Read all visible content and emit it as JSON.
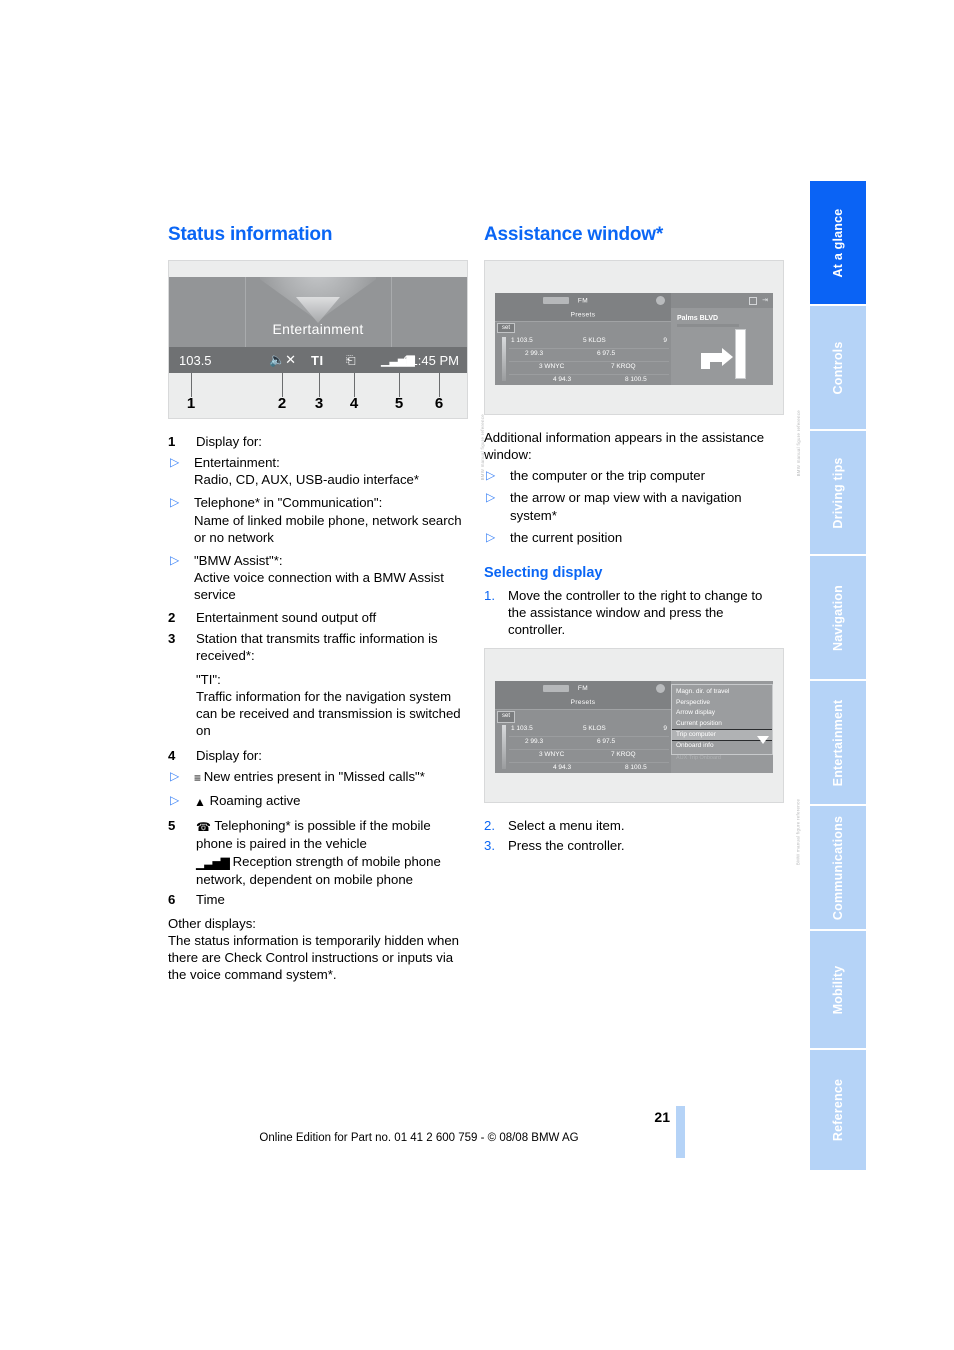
{
  "page": {
    "number": "21",
    "footer": "Online Edition for Part no. 01 41 2 600 759 - © 08/08 BMW AG",
    "accent_blue": "#0a66f5",
    "tab_blue": "#b5d3f7",
    "tab_active_blue": "#0a63f5"
  },
  "tabs": [
    {
      "label": "At a glance",
      "active": true
    },
    {
      "label": "Controls",
      "active": false
    },
    {
      "label": "Driving tips",
      "active": false
    },
    {
      "label": "Navigation",
      "active": false
    },
    {
      "label": "Entertainment",
      "active": false
    },
    {
      "label": "Communications",
      "active": false
    },
    {
      "label": "Mobility",
      "active": false
    },
    {
      "label": "Reference",
      "active": false
    }
  ],
  "left": {
    "title": "Status information",
    "figure": {
      "mode_label": "Entertainment",
      "status": {
        "frequency": "103.5",
        "mute_icon": "speaker-muted-icon",
        "ti": "TI",
        "message_icon": "message-icon",
        "signal_icon": "signal-bars-icon",
        "time": "01:45 PM"
      },
      "callouts": [
        "1",
        "2",
        "3",
        "4",
        "5",
        "6"
      ]
    },
    "items": [
      {
        "num": "1",
        "text": "Display for:",
        "subs": [
          "Entertainment:\nRadio, CD, AUX, USB-audio interface*",
          "Telephone* in \"Communication\":\nName of linked mobile phone, network search or no network",
          "\"BMW Assist\"*:\nActive voice connection with a BMW Assist service"
        ]
      },
      {
        "num": "2",
        "text": "Entertainment sound output off",
        "subs": []
      },
      {
        "num": "3",
        "text": "Station that transmits traffic information is received*:",
        "extra": "\"TI\":\nTraffic information for the navigation system can be received and transmission is switched on",
        "subs": []
      },
      {
        "num": "4",
        "text": "Display for:",
        "subs_icon": [
          {
            "icon": "list-icon",
            "text": "New entries present in \"Missed calls\"*"
          },
          {
            "icon": "triangle-icon",
            "text": "Roaming active"
          }
        ],
        "subs": []
      },
      {
        "num": "5",
        "icon_lines": [
          {
            "icon": "phone-handset-icon",
            "text": "Telephoning* is possible if the mobile phone is paired in the vehicle"
          },
          {
            "icon": "signal-bars-icon",
            "text": "Reception strength of mobile phone network, dependent on mobile phone"
          }
        ],
        "subs": []
      },
      {
        "num": "6",
        "text": "Time",
        "subs": []
      }
    ],
    "other_heading": "Other displays:",
    "other_text": "The status information is temporarily hidden when there are Check Control instructions or inputs via the voice command system*."
  },
  "right": {
    "title": "Assistance window*",
    "radio": {
      "band": "FM",
      "presets_label": "Presets",
      "set_label": "set",
      "rows": [
        {
          "a": "1 103.5",
          "b": "5 KLOS",
          "n": "9"
        },
        {
          "a": "2 99.3",
          "b": "6 97.5",
          "n": ""
        },
        {
          "a": "3 WNYC",
          "b": "7 KROQ",
          "n": ""
        },
        {
          "a": "4 94.3",
          "b": "8 100.5",
          "n": ""
        }
      ]
    },
    "assistance": {
      "street": "Palms BLVD",
      "turn_icon": "turn-right-arrow-icon"
    },
    "intro": "Additional information appears in the assistance window:",
    "bullets": [
      "the computer or the trip computer",
      "the arrow or map view with a navigation system*",
      "the current position"
    ],
    "sub_title": "Selecting display",
    "steps": [
      {
        "n": "1.",
        "text": "Move the controller to the right to change to the assistance window and press the controller."
      },
      {
        "n": "2.",
        "text": "Select a menu item."
      },
      {
        "n": "3.",
        "text": "Press the controller."
      }
    ],
    "menu": {
      "items": [
        {
          "label": "Magn. dir. of travel",
          "selected": false
        },
        {
          "label": "Perspective",
          "selected": false
        },
        {
          "label": "Arrow display",
          "selected": false
        },
        {
          "label": "Current position",
          "selected": false
        },
        {
          "label": "Trip computer",
          "selected": true
        },
        {
          "label": "Onboard info",
          "selected": false
        }
      ],
      "ghost": "AUX  Trip  Onboard"
    }
  },
  "figure_credit": "BMW manual figure reference"
}
